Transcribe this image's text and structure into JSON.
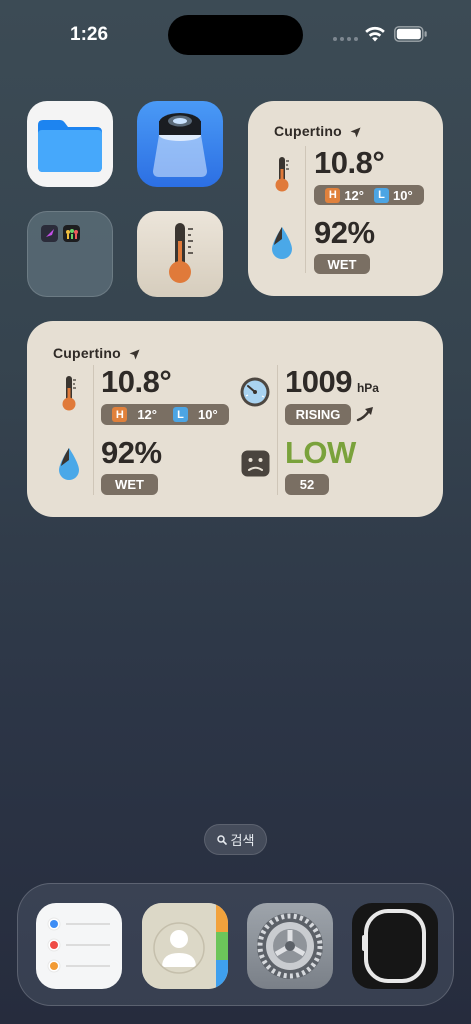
{
  "status": {
    "time": "1:26"
  },
  "apps": [
    {
      "id": "files",
      "icon": "files-folder-icon"
    },
    {
      "id": "lens",
      "icon": "magnifier-lens-icon"
    },
    {
      "id": "folder",
      "icon": "app-folder-icon"
    },
    {
      "id": "thermometer",
      "icon": "thermometer-icon"
    }
  ],
  "small_widget": {
    "city": "Cupertino",
    "temperature": "10.8°",
    "high": "12°",
    "low": "10°",
    "high_badge": "H",
    "low_badge": "L",
    "humidity": "92%",
    "humidity_label": "WET"
  },
  "medium_widget": {
    "city": "Cupertino",
    "temperature": "10.8°",
    "high": "12°",
    "low": "10°",
    "high_badge": "H",
    "low_badge": "L",
    "pressure": "1009",
    "pressure_unit": "hPa",
    "pressure_trend": "RISING",
    "humidity": "92%",
    "humidity_label": "WET",
    "air_quality": "LOW",
    "air_quality_value": "52",
    "colors": {
      "low_green": "#7aa23b",
      "pill": "#7a6f63"
    }
  },
  "search": {
    "label": "검색"
  },
  "dock": [
    {
      "id": "reminders",
      "icon": "reminders-icon"
    },
    {
      "id": "contacts",
      "icon": "contacts-icon"
    },
    {
      "id": "settings",
      "icon": "settings-gear-icon"
    },
    {
      "id": "watch",
      "icon": "watch-icon"
    }
  ]
}
